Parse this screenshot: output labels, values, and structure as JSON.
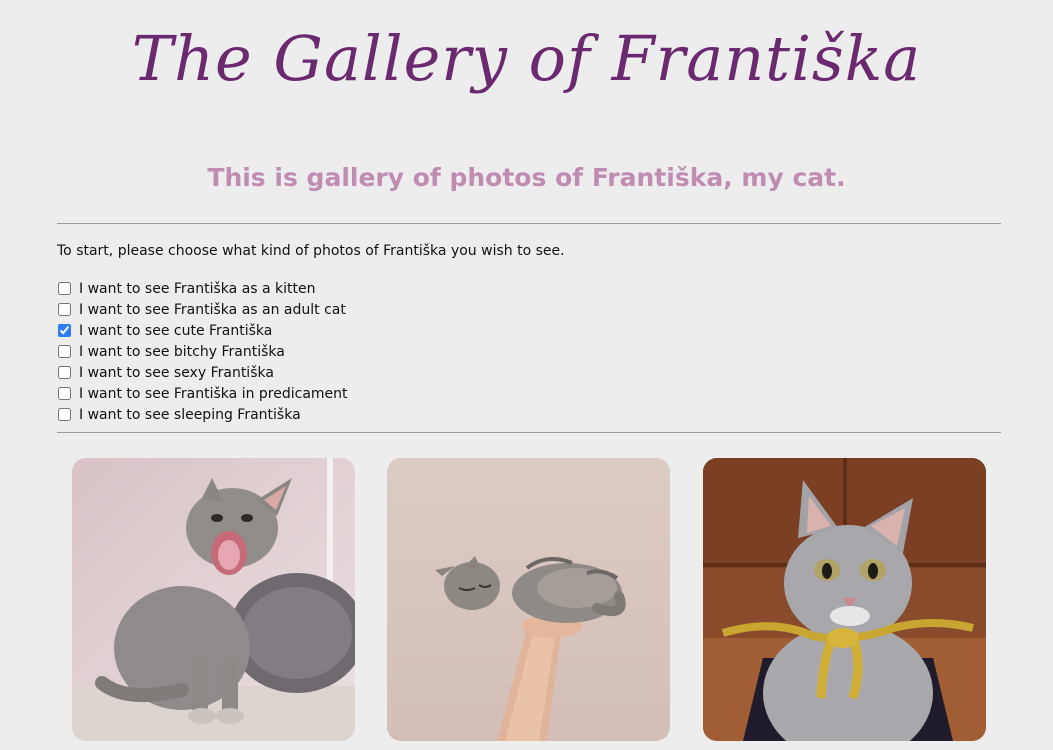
{
  "header": {
    "title": "The Gallery of Františka",
    "subtitle": "This is gallery of photos of Františka, my cat."
  },
  "intro": "To start, please choose what kind of photos of Františka you wish to see.",
  "filters": [
    {
      "label": "I want to see Františka as a kitten",
      "checked": false
    },
    {
      "label": "I want to see Františka as an adult cat",
      "checked": false
    },
    {
      "label": "I want to see cute Františka",
      "checked": true
    },
    {
      "label": "I want to see bitchy Františka",
      "checked": false
    },
    {
      "label": "I want to see sexy Františka",
      "checked": false
    },
    {
      "label": "I want to see Františka in predicament",
      "checked": false
    },
    {
      "label": "I want to see sleeping Františka",
      "checked": false
    }
  ],
  "photos": [
    {
      "subject": "yawning-kitten",
      "alt": "photo-1"
    },
    {
      "subject": "sleeping-kitten-in-hand",
      "alt": "photo-2"
    },
    {
      "subject": "kitten-with-golden-ribbon",
      "alt": "photo-3"
    }
  ],
  "colors": {
    "background": "#ededed",
    "title": "#6b2a70",
    "subtitle": "#c08cb2",
    "rule": "#999999",
    "checkbox_accent": "#2e7cf6"
  }
}
